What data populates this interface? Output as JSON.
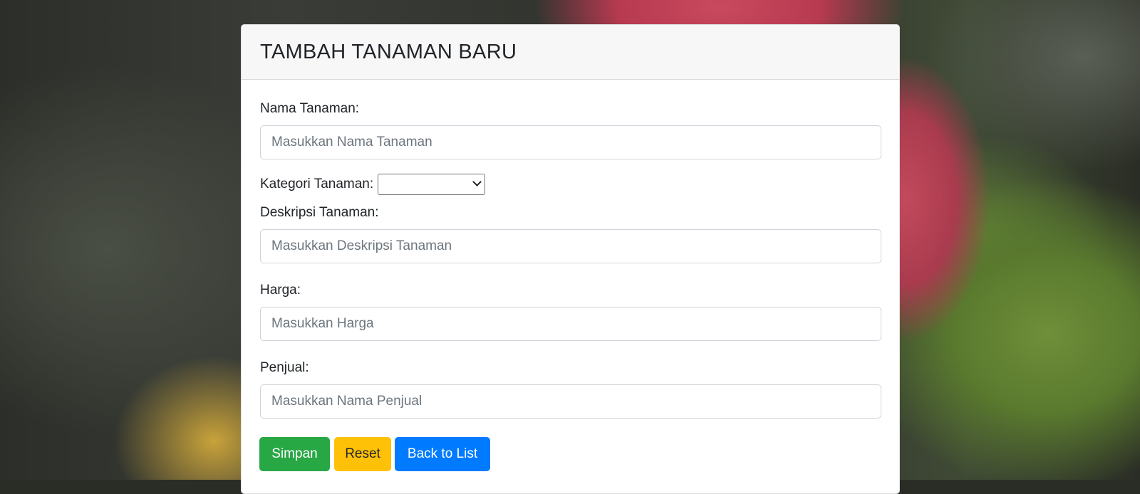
{
  "form": {
    "title": "TAMBAH TANAMAN BARU",
    "fields": {
      "nama_label": "Nama Tanaman:",
      "nama_placeholder": "Masukkan Nama Tanaman",
      "kategori_label": "Kategori Tanaman:",
      "kategori_value": "",
      "deskripsi_label": "Deskripsi Tanaman:",
      "deskripsi_placeholder": "Masukkan Deskripsi Tanaman",
      "harga_label": "Harga:",
      "harga_placeholder": "Masukkan Harga",
      "penjual_label": "Penjual:",
      "penjual_placeholder": "Masukkan Nama Penjual"
    },
    "buttons": {
      "save": "Simpan",
      "reset": "Reset",
      "back": "Back to List"
    }
  },
  "colors": {
    "save": "#28a745",
    "reset": "#ffc107",
    "back": "#007bff"
  }
}
